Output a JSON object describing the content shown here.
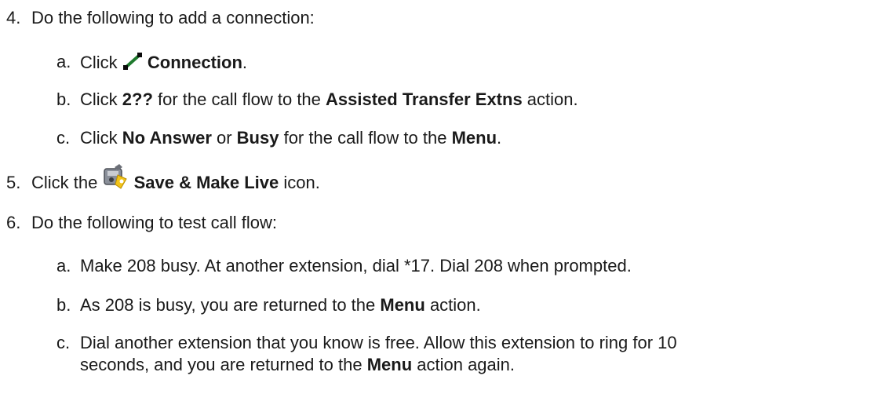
{
  "steps": [
    {
      "number": "4.",
      "text": "Do the following to add a connection:",
      "substeps": [
        {
          "letter": "a.",
          "pre": "Click ",
          "icon": "connection-icon",
          "bold1": "Connection",
          "post1": "."
        },
        {
          "letter": "b.",
          "pre": "Click ",
          "bold1": "2??",
          "mid": " for the call flow to the ",
          "bold2": "Assisted Transfer Extns",
          "post": " action."
        },
        {
          "letter": "c.",
          "pre": "Click ",
          "bold1": "No Answer",
          "mid": " or ",
          "bold2": "Busy",
          "mid2": " for the call flow to the ",
          "bold3": "Menu",
          "post": "."
        }
      ]
    },
    {
      "number": "5.",
      "pre": "Click the ",
      "icon": "save-make-live-icon",
      "bold1": "Save & Make Live",
      "post": " icon."
    },
    {
      "number": "6.",
      "text": "Do the following to test call flow:",
      "substeps": [
        {
          "letter": "a.",
          "text": "Make 208 busy. At another extension, dial *17. Dial 208 when prompted."
        },
        {
          "letter": "b.",
          "pre": "As 208 is busy, you are returned to the ",
          "bold1": "Menu",
          "post": " action."
        },
        {
          "letter": "c.",
          "line1": "Dial another extension that you know is free. Allow this extension to ring for 10",
          "pre2": "seconds, and you are returned to the ",
          "bold1": "Menu",
          "post": " action again."
        }
      ]
    }
  ]
}
